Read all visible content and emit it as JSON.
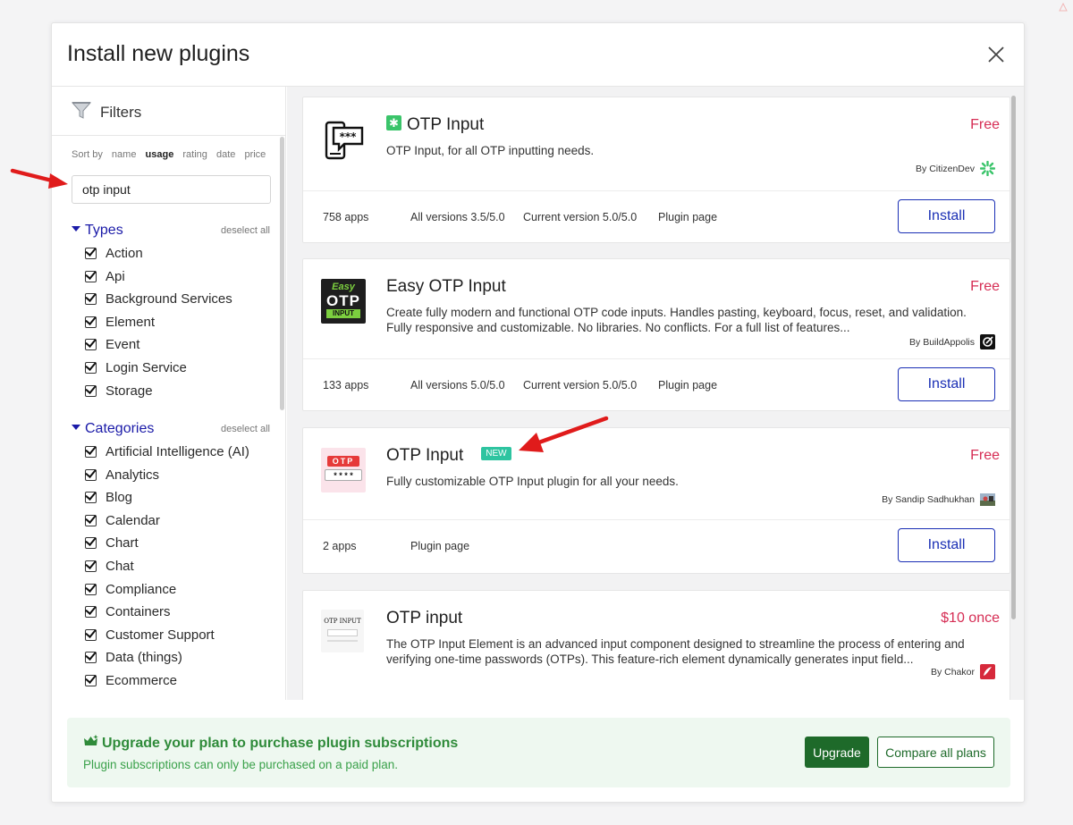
{
  "modal": {
    "title": "Install new plugins"
  },
  "filters": {
    "label": "Filters",
    "sort_by_label": "Sort by",
    "sort_options": [
      "name",
      "usage",
      "rating",
      "date",
      "price"
    ],
    "sort_active": "usage",
    "search_value": "otp input"
  },
  "types": {
    "title": "Types",
    "deselect": "deselect all",
    "items": [
      "Action",
      "Api",
      "Background Services",
      "Element",
      "Event",
      "Login Service",
      "Storage"
    ]
  },
  "categories": {
    "title": "Categories",
    "deselect": "deselect all",
    "items": [
      "Artificial Intelligence (AI)",
      "Analytics",
      "Blog",
      "Calendar",
      "Chart",
      "Chat",
      "Compliance",
      "Containers",
      "Customer Support",
      "Data (things)",
      "Ecommerce"
    ]
  },
  "plugins": [
    {
      "name": "OTP Input",
      "desc": "OTP Input, for all OTP inputting needs.",
      "price": "Free",
      "author": "By CitizenDev",
      "apps": "758 apps",
      "all_versions": "All versions 3.5/5.0",
      "current_version": "Current version 5.0/5.0",
      "plugin_page": "Plugin page",
      "install": "Install"
    },
    {
      "name": "Easy OTP Input",
      "desc": "Create fully modern and functional OTP code inputs. Handles pasting, keyboard, focus, reset, and validation. Fully responsive and customizable. No libraries. No conflicts. For a full list of features...",
      "price": "Free",
      "author": "By BuildAppolis",
      "apps": "133 apps",
      "all_versions": "All versions 5.0/5.0",
      "current_version": "Current version 5.0/5.0",
      "plugin_page": "Plugin page",
      "install": "Install",
      "logo_text": [
        "Easy",
        "OTP",
        "INPUT"
      ]
    },
    {
      "name": "OTP Input",
      "badge": "NEW",
      "desc": "Fully customizable OTP Input plugin for all your needs.",
      "price": "Free",
      "author": "By Sandip Sadhukhan",
      "apps": "2 apps",
      "plugin_page": "Plugin page",
      "install": "Install",
      "logo_text": [
        "OTP",
        "* * * *"
      ]
    },
    {
      "name": "OTP input",
      "desc": "The OTP Input Element is an advanced input component designed to streamline the process of entering and verifying one-time passwords (OTPs). This feature-rich element dynamically generates input field...",
      "price": "$10 once",
      "author": "By Chakor",
      "logo_text": "OTP INPUT"
    }
  ],
  "upgrade": {
    "title": "Upgrade your plan to purchase plugin subscriptions",
    "subtitle": "Plugin subscriptions can only be purchased on a paid plan.",
    "upgrade_btn": "Upgrade",
    "compare_btn": "Compare all plans"
  },
  "colors": {
    "accent_blue": "#1a2fb5",
    "price_red": "#d62e55",
    "upgrade_green": "#1e6a2a",
    "annotation_red": "#e01b1b"
  }
}
